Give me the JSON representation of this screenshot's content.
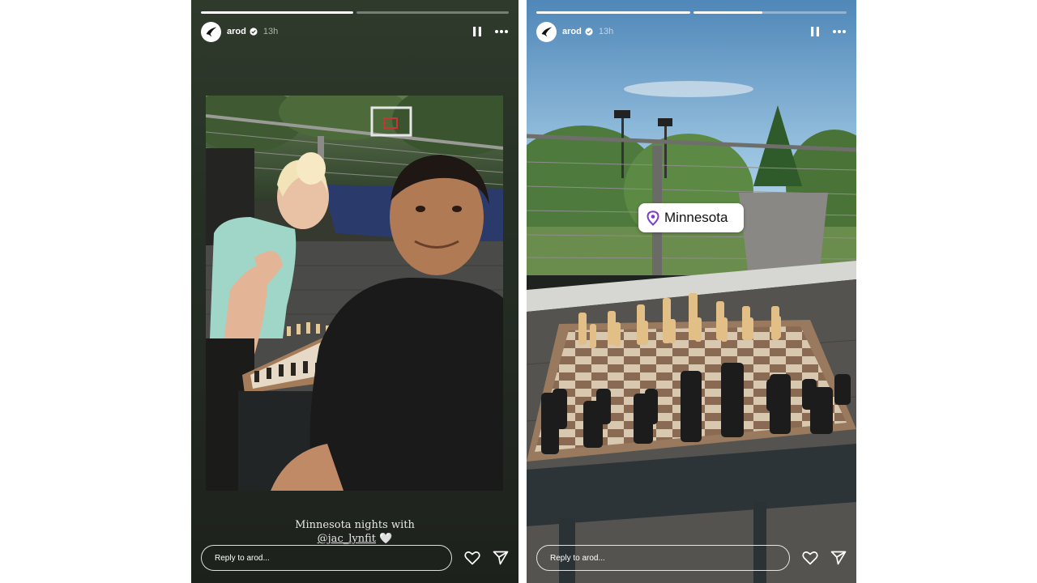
{
  "stories": [
    {
      "progress": [
        1,
        0
      ],
      "active_segment_fill": 0.45,
      "username": "arod",
      "time": "13h",
      "caption_line1": "Minnesota nights with",
      "caption_mention": "@jac_lynfit",
      "caption_emoji": "🤍",
      "reply_placeholder": "Reply to arod..."
    },
    {
      "progress": [
        1,
        0.45
      ],
      "username": "arod",
      "time": "13h",
      "location": "Minnesota",
      "reply_placeholder": "Reply to arod..."
    }
  ],
  "icons": {
    "pause": "pause-icon",
    "more": "more-icon",
    "heart": "heart-icon",
    "share": "send-icon",
    "verified": "verified-badge-icon",
    "location": "location-pin-icon"
  },
  "colors": {
    "story1_bg": "#263025",
    "location_pin": "#7b3fc4",
    "verified": "#ffffff"
  }
}
